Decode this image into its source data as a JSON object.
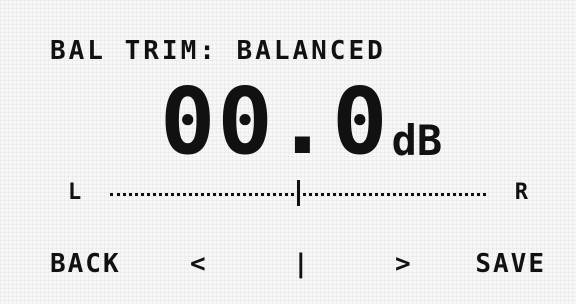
{
  "header": {
    "title": "BAL TRIM: BALANCED"
  },
  "readout": {
    "value": "00.0",
    "unit": "dB"
  },
  "balance": {
    "left_label": "L",
    "right_label": "R",
    "position": 0.0
  },
  "nav": {
    "back": "BACK",
    "decrease": "<",
    "center": "|",
    "increase": ">",
    "save": "SAVE"
  }
}
